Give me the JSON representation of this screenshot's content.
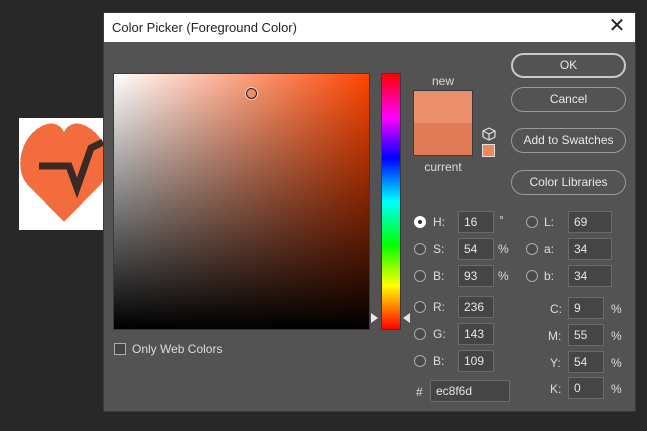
{
  "dialog": {
    "title": "Color Picker (Foreground Color)",
    "close_symbol": "✕"
  },
  "buttons": {
    "ok": "OK",
    "cancel": "Cancel",
    "add_to_swatches": "Add to Swatches",
    "color_libraries": "Color Libraries"
  },
  "swatch": {
    "new_label": "new",
    "current_label": "current",
    "new_color": "#ec8f6d",
    "current_color": "#e07a57",
    "websafe_color": "#ee8855"
  },
  "only_web_colors": {
    "label": "Only Web Colors",
    "checked": false
  },
  "hsb": {
    "h": {
      "label": "H:",
      "value": "16",
      "unit": "°"
    },
    "s": {
      "label": "S:",
      "value": "54",
      "unit": "%"
    },
    "b": {
      "label": "B:",
      "value": "93",
      "unit": "%"
    }
  },
  "rgb": {
    "r": {
      "label": "R:",
      "value": "236"
    },
    "g": {
      "label": "G:",
      "value": "143"
    },
    "b": {
      "label": "B:",
      "value": "109"
    }
  },
  "lab": {
    "l": {
      "label": "L:",
      "value": "69"
    },
    "a": {
      "label": "a:",
      "value": "34"
    },
    "b": {
      "label": "b:",
      "value": "34"
    }
  },
  "cmyk": {
    "c": {
      "label": "C:",
      "value": "9",
      "unit": "%"
    },
    "m": {
      "label": "M:",
      "value": "55",
      "unit": "%"
    },
    "y": {
      "label": "Y:",
      "value": "54",
      "unit": "%"
    },
    "k": {
      "label": "K:",
      "value": "0",
      "unit": "%"
    }
  },
  "hex": {
    "label": "#",
    "value": "ec8f6d"
  },
  "colors": {
    "dialog_bg": "#535353",
    "canvas_heart": "#f26c3d",
    "hue_base": "#ff4400"
  },
  "icons": {
    "cube": "cube-icon",
    "close": "close-icon"
  }
}
